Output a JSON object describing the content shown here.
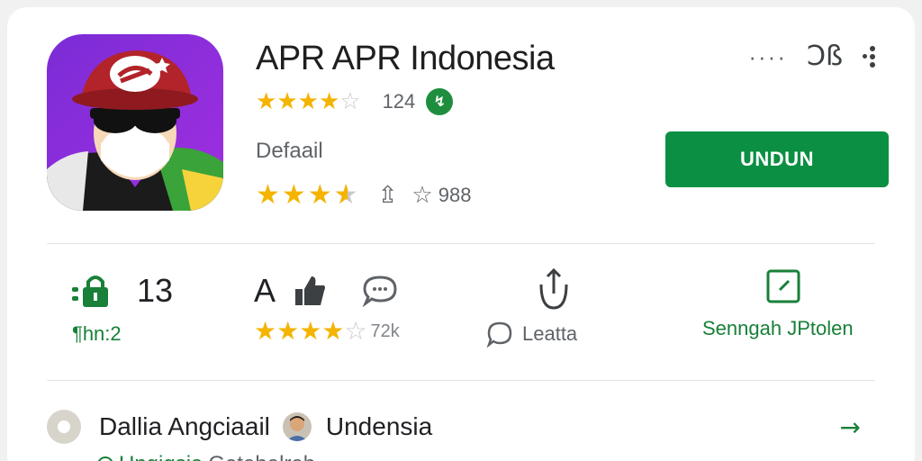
{
  "app": {
    "title": "APR APR Indonesia",
    "icon_name": "app-avatar-icon",
    "rating_count_top": "124",
    "category": "Defaail",
    "rating_count_bottom": "988",
    "install_label": "UNDUN"
  },
  "top_actions": {
    "share_text": "Ɔß",
    "icons": [
      "more-horizontal-icon",
      "share-icon",
      "more-vertical-icon"
    ]
  },
  "stats": {
    "downloads": {
      "value": "13",
      "label": "¶hn:2"
    },
    "rating_block": {
      "value": "A",
      "count": "72k"
    },
    "reviews": {
      "label": "Leatta"
    },
    "editors": {
      "label": "Senngah JPtolen"
    }
  },
  "developer": {
    "name": "Dallia Angciaail",
    "country": "Undensia"
  },
  "partial_row": {
    "link": "Ungigsia",
    "text": "Getabalrab"
  },
  "colors": {
    "accent_green": "#0b8f43",
    "star_gold": "#f4b400",
    "icon_bg_purple": "#8a2be2"
  }
}
